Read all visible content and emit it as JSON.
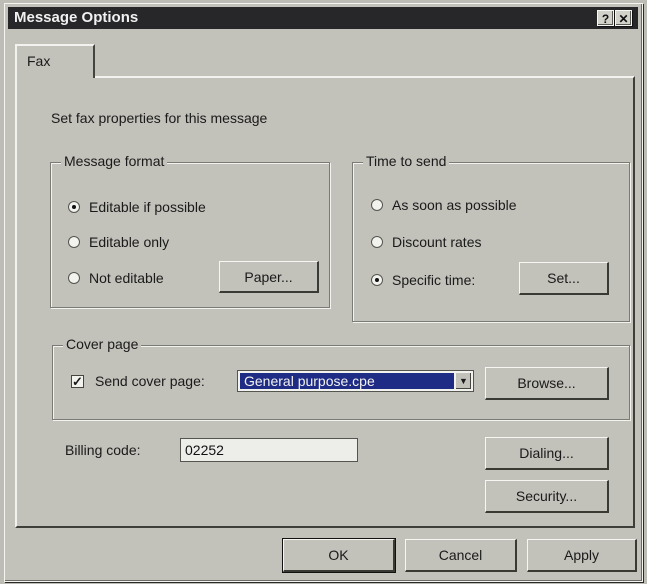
{
  "window": {
    "title": "Message Options",
    "help_glyph": "?",
    "close_glyph": "✕"
  },
  "tabs": [
    {
      "label": "Fax",
      "active": true
    }
  ],
  "intro_text": "Set fax properties for this message",
  "message_format": {
    "title": "Message format",
    "options": [
      {
        "label": "Editable  if possible",
        "selected": true
      },
      {
        "label": "Editable only",
        "selected": false
      },
      {
        "label": "Not editable",
        "selected": false
      }
    ],
    "paper_button": "Paper..."
  },
  "time_to_send": {
    "title": "Time to send",
    "options": [
      {
        "label": "As soon as possible",
        "selected": false
      },
      {
        "label": "Discount rates",
        "selected": false
      },
      {
        "label": "Specific time:",
        "selected": true
      }
    ],
    "set_button": "Set..."
  },
  "cover_page": {
    "title": "Cover page",
    "send_label": "Send cover page:",
    "send_checked": true,
    "template_value": "General purpose.cpe",
    "browse_button": "Browse..."
  },
  "billing": {
    "label": "Billing code:",
    "value": "02252"
  },
  "side_buttons": {
    "dialing": "Dialing...",
    "security": "Security..."
  },
  "footer_buttons": {
    "ok": "OK",
    "cancel": "Cancel",
    "apply": "Apply"
  }
}
